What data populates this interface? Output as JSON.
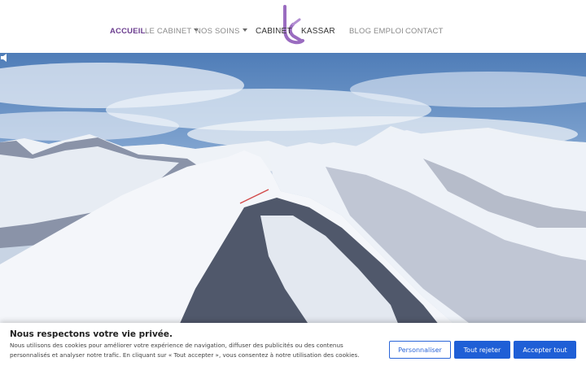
{
  "nav": {
    "accueil": "ACCUEIL",
    "cabinet": "LE CABINET",
    "soins": "NOS SOINS",
    "blog": "BLOG",
    "emploi": "EMPLOI",
    "contact": "CONTACT"
  },
  "logo": {
    "left_text": "CABINET",
    "right_text": "KASSAR"
  },
  "hero": {
    "sound_icon": "speaker-icon"
  },
  "cookie": {
    "title": "Nous respectons votre vie privée.",
    "text": "Nous utilisons des cookies pour améliorer votre expérience de navigation, diffuser des publicités ou des contenus personnalisés et analyser notre trafic. En cliquant sur « Tout accepter », vous consentez à notre utilisation des cookies.",
    "customize": "Personnaliser",
    "reject": "Tout rejeter",
    "accept": "Accepter tout"
  },
  "colors": {
    "brand_purple": "#6b3d8f",
    "logo_purple": "#9a6cc0",
    "button_blue": "#1f5fd6"
  }
}
